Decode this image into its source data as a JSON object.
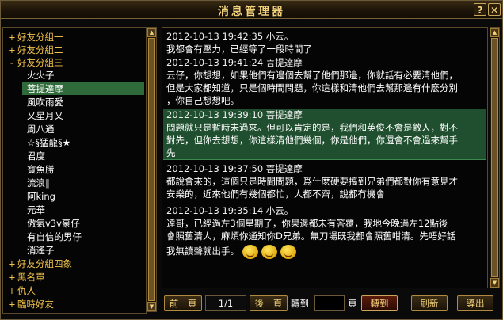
{
  "window": {
    "title": "消息管理器",
    "question_btn": "?",
    "close_btn": "✕"
  },
  "groups_top": [
    {
      "sign": "+",
      "label": "好友分組一"
    },
    {
      "sign": "+",
      "label": "好友分組二"
    },
    {
      "sign": "-",
      "label": "好友分組三"
    }
  ],
  "friends": [
    "火火子",
    "菩提達摩",
    "風吹雨愛",
    "乂星月乂",
    "周八通",
    "☆§猛龍§★",
    "君度",
    "寶魚勝",
    "流浪∥",
    "阿king",
    "元華",
    "傲氣v3v豪仔",
    "有自信的男仔",
    "消遙子"
  ],
  "selected_friend_index": 1,
  "groups_bottom": [
    {
      "sign": "+",
      "label": "好友分組四象"
    },
    {
      "sign": "+",
      "label": "黑名單"
    },
    {
      "sign": "+",
      "label": "仇人"
    },
    {
      "sign": "+",
      "label": "臨時好友"
    }
  ],
  "messages": [
    {
      "header": "2012-10-13  19:42:35 小云。",
      "lines": [
        "我都會有壓力，已經等了一段時間了"
      ],
      "highlight": false
    },
    {
      "header": "2012-10-13  19:41:24 菩提達摩",
      "lines": [
        "云仔，你想想，如果他們有邊個去幫了他們那邊，你就話有必要清他們，",
        "但是大家都知道，只是個時間問題，你這樣和清他們去幫那邊有什麼分別",
        "，你自己想想吧。"
      ],
      "highlight": false
    },
    {
      "header": "2012-10-13  19:39:10 菩提達摩",
      "lines": [
        "問題就只是暫時未過來。但可以肯定的是，我們和英俊不會是敵人，對不",
        "對先，但你去想想，你這樣清他們幾個，你是他們，你還會不會過來幫手",
        "先"
      ],
      "highlight": true
    },
    {
      "header": "2012-10-13  19:37:50 菩提達摩",
      "lines": [
        "都說會來的，這個只是時間問題，爲什麽硬要搞到兄弟們都對你有意見才",
        "安樂的，近來他們有幾個都忙，人都不齊，說都冇機會"
      ],
      "highlight": false
    },
    {
      "header": "2012-10-13  19:35:14 小云。",
      "lines": [
        "達哥，已經過左3個星期了，你果邊都未有答覆，我地今晚過左12點後",
        "會照舊清人，麻煩你通知你D兄弟。無刀場既我都會照舊咁清。先唔好話",
        "我無讀聲就出手。"
      ],
      "highlight": false
    }
  ],
  "bottom": {
    "prev_page": "前一頁",
    "page_indicator": "1/1",
    "next_page": "後一頁",
    "goto_label": "轉到",
    "page_unit": "頁",
    "goto_button": "轉到",
    "refresh_button": "刷新",
    "export_button": "導出"
  },
  "colors": {
    "group_text": "#f2c24a",
    "selected_bg": "#2f6a3a",
    "highlight_bg": "#1f4f2e",
    "title": "#f3d27a"
  }
}
